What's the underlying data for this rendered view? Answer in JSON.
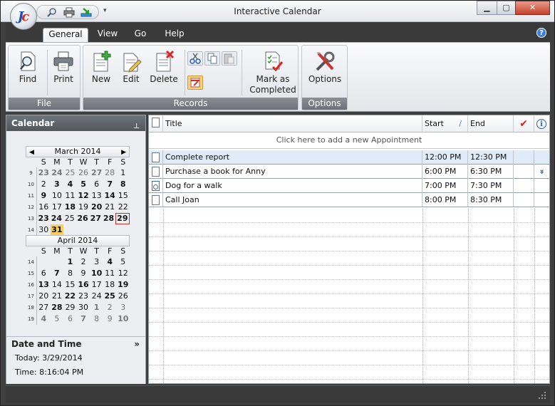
{
  "window": {
    "title": "Interactive Calendar",
    "logo": "Jc"
  },
  "quick_access": [
    "search-icon",
    "print-icon",
    "export-icon"
  ],
  "menu": {
    "tabs": [
      "General",
      "View",
      "Go",
      "Help"
    ],
    "active": "General"
  },
  "ribbon": {
    "groups": [
      {
        "label": "File",
        "buttons": [
          "Find",
          "Print"
        ]
      },
      {
        "label": "Records",
        "buttons": [
          "New",
          "Edit",
          "Delete",
          "Mark as Completed"
        ],
        "small": [
          "cut-icon",
          "copy-icon",
          "paste-icon",
          "calendar-edit-icon"
        ]
      },
      {
        "label": "Options",
        "buttons": [
          "Options"
        ]
      }
    ],
    "mark_completed_line1": "Mark as",
    "mark_completed_line2": "Completed"
  },
  "sidebar": {
    "title": "Calendar",
    "dow": [
      "S",
      "M",
      "T",
      "W",
      "T",
      "F",
      "S"
    ],
    "months": [
      {
        "label": "March 2014",
        "weeks": [
          {
            "wk": "9",
            "days": [
              [
                "23",
                "bg"
              ],
              [
                "24",
                "bg"
              ],
              [
                "25",
                "g"
              ],
              [
                "26",
                "g"
              ],
              [
                "27",
                "bg"
              ],
              [
                "28",
                "g"
              ],
              [
                "1",
                ""
              ]
            ]
          },
          {
            "wk": "10",
            "days": [
              [
                "2",
                ""
              ],
              [
                "3",
                "b"
              ],
              [
                "4",
                "b"
              ],
              [
                "5",
                "b"
              ],
              [
                "6",
                ""
              ],
              [
                "7",
                "b"
              ],
              [
                "8",
                "b"
              ]
            ]
          },
          {
            "wk": "11",
            "days": [
              [
                "9",
                "b"
              ],
              [
                "10",
                ""
              ],
              [
                "11",
                ""
              ],
              [
                "12",
                "b"
              ],
              [
                "13",
                ""
              ],
              [
                "14",
                "b"
              ],
              [
                "15",
                ""
              ]
            ]
          },
          {
            "wk": "12",
            "days": [
              [
                "16",
                ""
              ],
              [
                "17",
                ""
              ],
              [
                "18",
                "b"
              ],
              [
                "19",
                ""
              ],
              [
                "20",
                "b"
              ],
              [
                "21",
                ""
              ],
              [
                "22",
                ""
              ]
            ]
          },
          {
            "wk": "13",
            "days": [
              [
                "23",
                "b"
              ],
              [
                "24",
                "b"
              ],
              [
                "25",
                ""
              ],
              [
                "26",
                "b"
              ],
              [
                "27",
                "b"
              ],
              [
                "28",
                "b"
              ],
              [
                "29",
                "today"
              ]
            ]
          },
          {
            "wk": "14",
            "days": [
              [
                "30",
                ""
              ],
              [
                "31",
                "sel"
              ],
              [
                "",
                ""
              ],
              [
                "",
                ""
              ],
              [
                "",
                ""
              ],
              [
                "",
                ""
              ],
              [
                "",
                ""
              ]
            ]
          }
        ]
      },
      {
        "label": "April 2014",
        "weeks": [
          {
            "wk": "14",
            "days": [
              [
                "",
                ""
              ],
              [
                "",
                ""
              ],
              [
                "1",
                "b"
              ],
              [
                "2",
                ""
              ],
              [
                "3",
                ""
              ],
              [
                "4",
                "b"
              ],
              [
                "5",
                ""
              ]
            ]
          },
          {
            "wk": "15",
            "days": [
              [
                "6",
                ""
              ],
              [
                "7",
                "b"
              ],
              [
                "8",
                ""
              ],
              [
                "9",
                ""
              ],
              [
                "10",
                "b"
              ],
              [
                "11",
                ""
              ],
              [
                "12",
                ""
              ]
            ]
          },
          {
            "wk": "16",
            "days": [
              [
                "13",
                "b"
              ],
              [
                "14",
                ""
              ],
              [
                "15",
                ""
              ],
              [
                "16",
                "b"
              ],
              [
                "17",
                ""
              ],
              [
                "18",
                ""
              ],
              [
                "19",
                "b"
              ]
            ]
          },
          {
            "wk": "17",
            "days": [
              [
                "20",
                ""
              ],
              [
                "21",
                ""
              ],
              [
                "22",
                "b"
              ],
              [
                "23",
                ""
              ],
              [
                "24",
                ""
              ],
              [
                "25",
                "b"
              ],
              [
                "26",
                ""
              ]
            ]
          },
          {
            "wk": "18",
            "days": [
              [
                "27",
                ""
              ],
              [
                "28",
                "b"
              ],
              [
                "29",
                ""
              ],
              [
                "30",
                ""
              ],
              [
                "1",
                "bg"
              ],
              [
                "2",
                "g"
              ],
              [
                "3",
                "g"
              ]
            ]
          },
          {
            "wk": "19",
            "days": [
              [
                "4",
                "bg"
              ],
              [
                "5",
                "g"
              ],
              [
                "6",
                "g"
              ],
              [
                "7",
                "bg"
              ],
              [
                "8",
                "g"
              ],
              [
                "9",
                "g"
              ],
              [
                "10",
                "bg"
              ]
            ]
          }
        ]
      }
    ],
    "datetime": {
      "title": "Date and Time",
      "today": "Today: 3/29/2014",
      "time": "Time: 8:16:04 PM"
    }
  },
  "grid": {
    "columns": {
      "title": "Title",
      "start": "Start",
      "end": "End"
    },
    "add_prompt": "Click here to add a new Appointment",
    "rows": [
      {
        "title": "Complete report",
        "start": "12:00 PM",
        "end": "12:30 PM",
        "selected": true,
        "icon": "document-icon",
        "info": ""
      },
      {
        "title": "Purchase a book for Anny",
        "start": "6:00 PM",
        "end": "6:30 PM",
        "selected": false,
        "icon": "document-icon",
        "info": "»"
      },
      {
        "title": "Dog for a walk",
        "start": "7:00 PM",
        "end": "7:30 PM",
        "selected": false,
        "icon": "recurring-document-icon",
        "info": ""
      },
      {
        "title": "Call Joan",
        "start": "8:00 PM",
        "end": "8:30 PM",
        "selected": false,
        "icon": "document-icon",
        "info": ""
      }
    ]
  },
  "colors": {
    "accent": "#3d7fd8",
    "selection": "#f7cf5e",
    "today_border": "#c0302a",
    "chrome_dark": "#3a3a3a"
  }
}
